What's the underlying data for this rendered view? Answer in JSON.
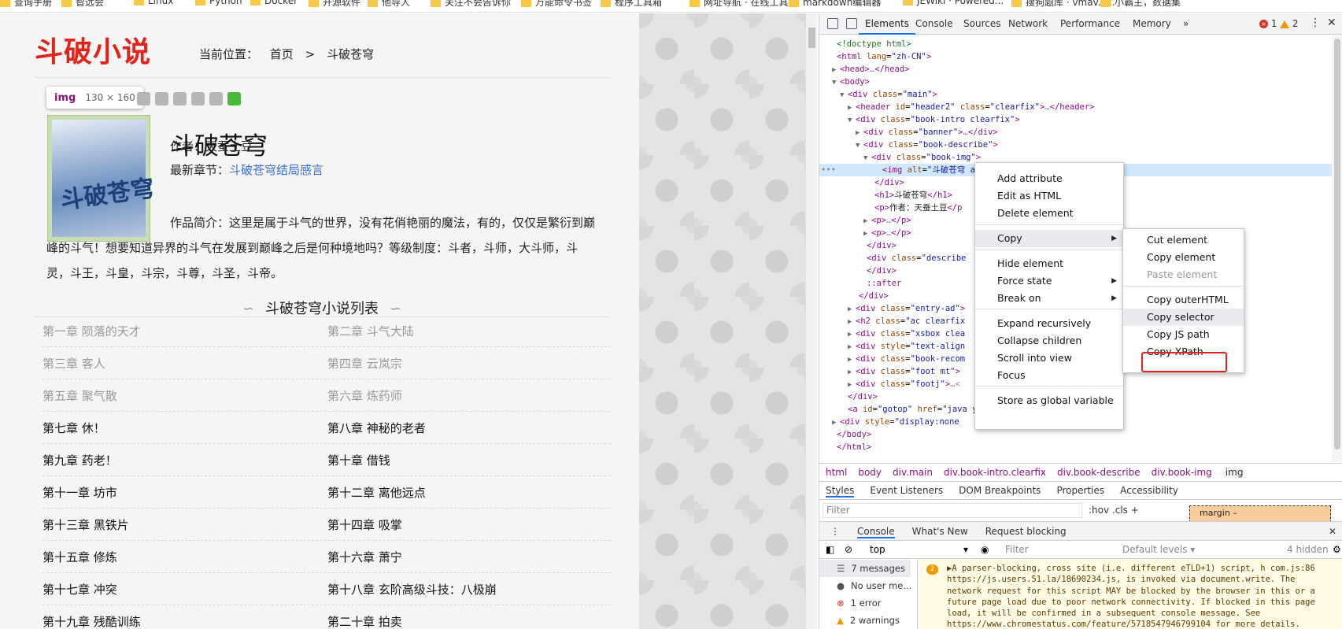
{
  "bookmarks": [
    {
      "label": "查询手册"
    },
    {
      "label": "智远会"
    },
    {
      "label": "Linux"
    },
    {
      "label": "Python"
    },
    {
      "label": "Docker"
    },
    {
      "label": "开源软件"
    },
    {
      "label": "他导人"
    },
    {
      "label": "关注不会告诉你"
    },
    {
      "label": "万能命令书签"
    },
    {
      "label": "程序工具箱"
    },
    {
      "label": "网址导航 · 在线工具"
    },
    {
      "label": "markdown编辑器"
    },
    {
      "label": "JEWiki · Powered..."
    },
    {
      "label": "搜狗题库 · vmav.c..."
    },
    {
      "label": "小霸主，数据集"
    }
  ],
  "site": {
    "logo": "斗破小说",
    "crumb_label": "当前位置：",
    "crumb_home": "首页",
    "crumb_sep": ">",
    "crumb_current": "斗破苍穹"
  },
  "inspect_tip": {
    "tag": "img",
    "size": "130 × 160"
  },
  "book": {
    "cover_text": "斗破苍穹",
    "title": "斗破苍穹",
    "author": "作者：天蚕土豆",
    "latest_label": "最新章节：",
    "latest_link": "斗破苍穹结局感言",
    "intro": "作品简介：这里是属于斗气的世界，没有花俏艳丽的魔法，有的，仅仅是繁衍到巅峰的斗气！想要知道异界的斗气在发展到巅峰之后是何种境地吗？等级制度：斗者，斗师，大斗师，斗灵，斗王，斗皇，斗宗，斗尊，斗圣，斗帝。"
  },
  "chapter_list": {
    "heading": "斗破苍穹小说列表",
    "chapters": [
      {
        "title": "第一章 陨落的天才",
        "visited": true
      },
      {
        "title": "第二章 斗气大陆",
        "visited": true
      },
      {
        "title": "第三章 客人",
        "visited": true
      },
      {
        "title": "第四章 云岚宗",
        "visited": true
      },
      {
        "title": "第五章 聚气散",
        "visited": true
      },
      {
        "title": "第六章 炼药师",
        "visited": true
      },
      {
        "title": "第七章 休！",
        "visited": false
      },
      {
        "title": "第八章 神秘的老者",
        "visited": false
      },
      {
        "title": "第九章 药老！",
        "visited": false
      },
      {
        "title": "第十章 借钱",
        "visited": false
      },
      {
        "title": "第十一章 坊市",
        "visited": false
      },
      {
        "title": "第十二章 离他远点",
        "visited": false
      },
      {
        "title": "第十三章 黑铁片",
        "visited": false
      },
      {
        "title": "第十四章 吸掌",
        "visited": false
      },
      {
        "title": "第十五章 修炼",
        "visited": false
      },
      {
        "title": "第十六章 萧宁",
        "visited": false
      },
      {
        "title": "第十七章 冲突",
        "visited": false
      },
      {
        "title": "第十八章 玄阶高级斗技：八极崩",
        "visited": false
      },
      {
        "title": "第十九章 残酷训练",
        "visited": false
      },
      {
        "title": "第二十章 拍卖",
        "visited": false
      }
    ]
  },
  "devtools": {
    "tabs": [
      "Elements",
      "Console",
      "Sources",
      "Network",
      "Performance",
      "Memory",
      "»"
    ],
    "errors": "1",
    "warnings": "2",
    "dom_lines": [
      {
        "tw": "",
        "html": "<span class='cm'>&lt;!doctype html&gt;</span>"
      },
      {
        "tw": "",
        "html": "<span class='tg'>&lt;html</span> <span class='at'>lang</span>=<span class='av'>\"zh-CN\"</span><span class='tg'>&gt;</span>"
      },
      {
        "tw": "▶",
        "html": "<span class='tg'>&lt;head&gt;</span><span class='gr'>…</span><span class='tg'>&lt;/head&gt;</span>"
      },
      {
        "tw": "▼",
        "html": "<span class='tg'>&lt;body&gt;</span>"
      },
      {
        "tw": "▼",
        "html": "<span class='tg'>&lt;div</span> <span class='at'>class</span>=<span class='av'>\"main\"</span><span class='tg'>&gt;</span>"
      },
      {
        "tw": "▶",
        "html": "<span class='tg'>&lt;header</span> <span class='at'>id</span>=<span class='av'>\"header2\"</span> <span class='at'>class</span>=<span class='av'>\"clearfix\"</span><span class='tg'>&gt;</span><span class='gr'>…</span><span class='tg'>&lt;/header&gt;</span>"
      },
      {
        "tw": "▼",
        "html": "<span class='tg'>&lt;div</span> <span class='at'>class</span>=<span class='av'>\"book-intro clearfix\"</span><span class='tg'>&gt;</span>"
      },
      {
        "tw": "▶",
        "html": "<span class='tg'>&lt;div</span> <span class='at'>class</span>=<span class='av'>\"banner\"</span><span class='tg'>&gt;</span><span class='gr'>…</span><span class='tg'>&lt;/div&gt;</span>"
      },
      {
        "tw": "▼",
        "html": "<span class='tg'>&lt;div</span> <span class='at'>class</span>=<span class='av'>\"book-describe\"</span><span class='tg'>&gt;</span>"
      },
      {
        "tw": "▼",
        "html": "<span class='tg'>&lt;div</span> <span class='at'>class</span>=<span class='av'>\"book-img\"</span><span class='tg'>&gt;</span>"
      },
      {
        "tw": "",
        "html": "<span class='tg'>&lt;img</span> <span class='at'>alt</span>=<span class='av'>\"斗破苍穹</span>                                     <span class='av'>anggiong.jpg\"</span><span class='tg'>&gt;</span> <span class='gr'>== $0</span>"
      },
      {
        "tw": "",
        "html": "<span class='tg'>&lt;/div&gt;</span>"
      },
      {
        "tw": "",
        "html": "<span class='tg'>&lt;h1&gt;</span><span class='tx'>斗破苍穹</span><span class='tg'>&lt;/h1&gt;</span>"
      },
      {
        "tw": "",
        "html": "<span class='tg'>&lt;p&gt;</span><span class='tx'>作者：天蚕土豆</span><span class='tg'>&lt;/p</span>"
      },
      {
        "tw": "▶",
        "html": "<span class='tg'>&lt;p&gt;</span><span class='gr'>…</span><span class='tg'>&lt;/p&gt;</span>"
      },
      {
        "tw": "▶",
        "html": "<span class='tg'>&lt;p&gt;</span><span class='gr'>…</span><span class='tg'>&lt;/p&gt;</span>"
      },
      {
        "tw": "",
        "html": "<span class='tg'>&lt;/div&gt;</span>"
      },
      {
        "tw": "",
        "html": "<span class='tg'>&lt;div</span> <span class='at'>class</span>=<span class='av'>\"describe</span>"
      },
      {
        "tw": "",
        "html": "<span class='tg'>&lt;/div&gt;</span>"
      },
      {
        "tw": "",
        "html": "<span class='tg'>::after</span>"
      },
      {
        "tw": "",
        "html": "<span class='tg'>&lt;/div&gt;</span>"
      },
      {
        "tw": "▶",
        "html": "<span class='tg'>&lt;div</span> <span class='at'>class</span>=<span class='av'>\"entry-ad\"</span><span class='tg'>&gt;</span>"
      },
      {
        "tw": "▶",
        "html": "<span class='tg'>&lt;h2</span> <span class='at'>class</span>=<span class='av'>\"ac clearfix</span>"
      },
      {
        "tw": "▶",
        "html": "<span class='tg'>&lt;div</span> <span class='at'>class</span>=<span class='av'>\"xsbox clea</span>"
      },
      {
        "tw": "▶",
        "html": "<span class='tg'>&lt;div</span> <span class='at'>style</span>=<span class='av'>\"text-align</span>"
      },
      {
        "tw": "▶",
        "html": "<span class='tg'>&lt;div</span> <span class='at'>class</span>=<span class='av'>\"book-recom</span>"
      },
      {
        "tw": "▶",
        "html": "<span class='tg'>&lt;div</span> <span class='at'>class</span>=<span class='av'>\"foot mt\"</span><span class='tg'>&gt;</span>"
      },
      {
        "tw": "▶",
        "html": "<span class='tg'>&lt;div</span> <span class='at'>class</span>=<span class='av'>\"footj\"</span><span class='tg'>&gt;</span><span class='gr'>…&lt;</span>"
      },
      {
        "tw": "",
        "html": "<span class='tg'>&lt;/div&gt;</span>"
      },
      {
        "tw": "",
        "html": "<span class='tg'>&lt;a</span> <span class='at'>id</span>=<span class='av'>\"gotop\"</span> <span class='at'>href</span>=<span class='av'>\"java</span>                                    <span class='av'>y: none;\"</span><span class='tg'>&gt;&lt;/a&gt;</span>"
      },
      {
        "tw": "▶",
        "html": "<span class='tg'>&lt;div</span> <span class='at'>style</span>=<span class='av'>\"display:none</span>"
      },
      {
        "tw": "",
        "html": "<span class='tg'>&lt;/body&gt;</span>"
      },
      {
        "tw": "",
        "html": "<span class='tg'>&lt;/html&gt;</span>"
      }
    ],
    "breadcrumb": [
      "html",
      "body",
      "div.main",
      "div.book-intro.clearfix",
      "div.book-describe",
      "div.book-img",
      "img"
    ],
    "styles_tabs": [
      "Styles",
      "Event Listeners",
      "DOM Breakpoints",
      "Properties",
      "Accessibility"
    ],
    "filter_placeholder": "Filter",
    "hov_cls": ":hov  .cls  +",
    "box_model_label": "margin        –",
    "drawer_tabs": [
      "Console",
      "What's New",
      "Request blocking"
    ],
    "console_context": "top",
    "console_filter": "Filter",
    "console_levels": "Default levels ▾",
    "console_hidden": "4 hidden",
    "console_side": [
      {
        "label": "7 messages"
      },
      {
        "label": "No user me..."
      },
      {
        "label": "1 error"
      },
      {
        "label": "2 warnings"
      }
    ],
    "console_badge": "2",
    "console_message": "▶A parser-blocking, cross site (i.e. different eTLD+1) script, h com.js:86 https://js.users.51.la/18690234.js, is invoked via document.write. The network request for this script MAY be blocked by the browser in this or a future page load due to poor network connectivity. If blocked in this page load, it will be confirmed in a subsequent console message. See https://www.chromestatus.com/feature/5718547946799104 for more details."
  },
  "context_menu": {
    "items": [
      {
        "label": "Add attribute"
      },
      {
        "label": "Edit as HTML"
      },
      {
        "label": "Delete element"
      },
      {
        "label": "Copy",
        "submenu": true
      },
      {
        "label": "Hide element"
      },
      {
        "label": "Force state",
        "submenu": true
      },
      {
        "label": "Break on",
        "submenu": true
      },
      {
        "label": "Expand recursively"
      },
      {
        "label": "Collapse children"
      },
      {
        "label": "Scroll into view"
      },
      {
        "label": "Focus"
      },
      {
        "label": "Store as global variable"
      }
    ]
  },
  "copy_submenu": {
    "items": [
      {
        "label": "Cut element"
      },
      {
        "label": "Copy element"
      },
      {
        "label": "Paste element",
        "disabled": true
      },
      {
        "label": "Copy outerHTML"
      },
      {
        "label": "Copy selector"
      },
      {
        "label": "Copy JS path"
      },
      {
        "label": "Copy XPath"
      }
    ],
    "highlight_color": "#e02424"
  }
}
